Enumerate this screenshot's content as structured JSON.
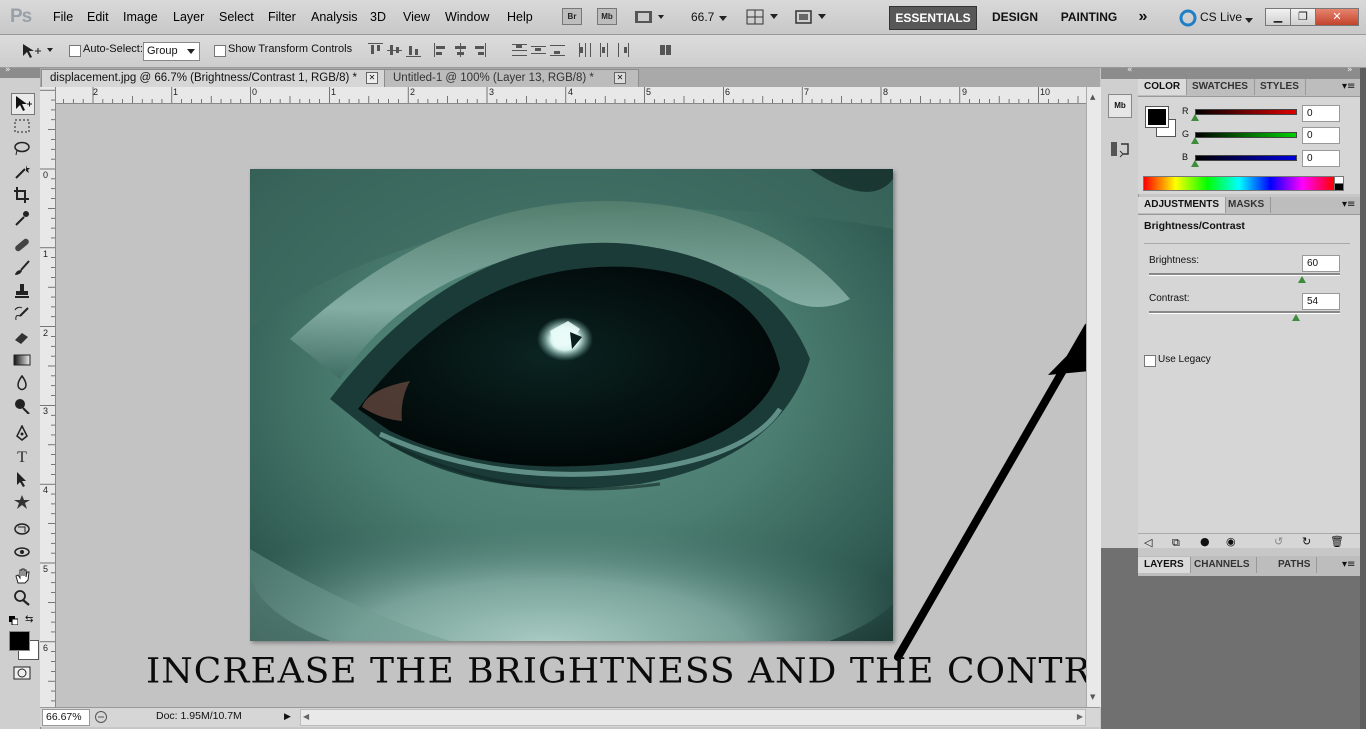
{
  "app": {
    "logo": "Ps",
    "menus": [
      "File",
      "Edit",
      "Image",
      "Layer",
      "Select",
      "Filter",
      "Analysis",
      "3D",
      "View",
      "Window",
      "Help"
    ],
    "bridge_label": "Br",
    "minibridge_label": "Mb",
    "zoom_value": "66.7",
    "workspaces": [
      "ESSENTIALS",
      "DESIGN",
      "PAINTING"
    ],
    "workspace_more": "»",
    "cs_live": "CS Live"
  },
  "options": {
    "auto_select_label": "Auto-Select:",
    "auto_select_value": "Group",
    "show_transform_label": "Show Transform Controls"
  },
  "tabs": [
    {
      "label": "displacement.jpg @ 66.7% (Brightness/Contrast 1, RGB/8) *",
      "active": true
    },
    {
      "label": "Untitled-1 @ 100% (Layer 13, RGB/8) *",
      "active": false
    }
  ],
  "rulers": {
    "top": [
      "2",
      "1",
      "0",
      "1",
      "2",
      "3",
      "4",
      "5",
      "6",
      "7",
      "8",
      "9",
      "10"
    ],
    "left": [
      "0",
      "1",
      "2",
      "3",
      "4",
      "5",
      "6"
    ]
  },
  "status": {
    "zoom": "66.67%",
    "doc": "Doc: 1.95M/10.7M"
  },
  "color_panel": {
    "tabs": [
      "COLOR",
      "SWATCHES",
      "STYLES"
    ],
    "channels": [
      {
        "label": "R",
        "value": "0",
        "color": "#d01010"
      },
      {
        "label": "G",
        "value": "0",
        "color": "#10c010"
      },
      {
        "label": "B",
        "value": "0",
        "color": "#1010d0"
      }
    ]
  },
  "adjustments": {
    "tabs": [
      "ADJUSTMENTS",
      "MASKS"
    ],
    "title": "Brightness/Contrast",
    "brightness_label": "Brightness:",
    "brightness_value": "60",
    "brightness_level": 0.8,
    "contrast_label": "Contrast:",
    "contrast_value": "54",
    "contrast_level": 0.77,
    "use_legacy_label": "Use Legacy"
  },
  "layers_panel": {
    "tabs": [
      "LAYERS",
      "CHANNELS",
      "PATHS"
    ]
  },
  "caption": "INCREASE THE BRIGHTNESS AND THE CONTRAST"
}
